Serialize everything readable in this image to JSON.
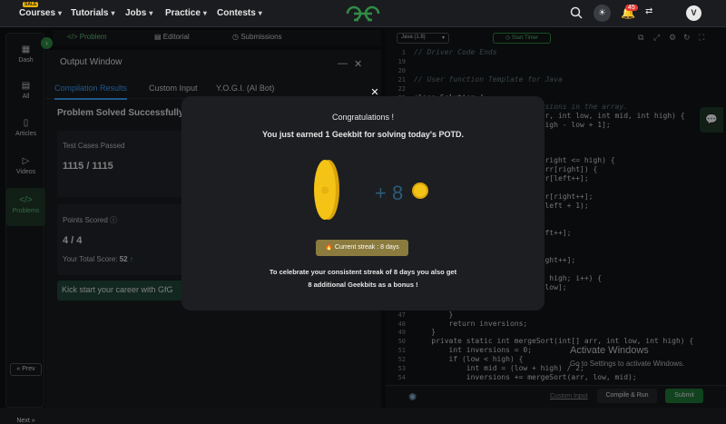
{
  "nav": {
    "sale_badge": "SALE",
    "items": [
      "Courses",
      "Tutorials",
      "Jobs",
      "Practice",
      "Contests"
    ],
    "notification_count": "45",
    "avatar_initial": "V"
  },
  "sidebar": {
    "items": [
      "Dash",
      "All",
      "Articles",
      "Videos",
      "Problems"
    ],
    "prev_label": "« Prev",
    "next_label": "Next »"
  },
  "problem_tabs": [
    "Problem",
    "Editorial",
    "Submissions"
  ],
  "output": {
    "title": "Output Window",
    "tabs": [
      "Compilation Results",
      "Custom Input",
      "Y.O.G.I. (AI Bot)"
    ],
    "status": "Problem Solved Successfully",
    "test_cases_label": "Test Cases Passed",
    "test_cases_value": "1115 / 1115",
    "points_label": "Points Scored",
    "points_value": "4 / 4",
    "total_score_label": "Your Total Score:",
    "total_score_value": "52",
    "kickstart": "Kick start your career with GfG"
  },
  "editor": {
    "language": "Java (1.8)",
    "timer_label": "Start Timer",
    "lines": [
      {
        "n": "1",
        "code": "// Driver Code Ends"
      },
      {
        "n": "19",
        "code": ""
      },
      {
        "n": "20",
        "code": ""
      },
      {
        "n": "21",
        "code": "// User function Template for Java"
      },
      {
        "n": "22",
        "code": ""
      },
      {
        "n": "23",
        "code": "class Solution {"
      },
      {
        "n": "24",
        "code": "    // Function to count inversions in the array."
      },
      {
        "n": "25",
        "code": "    static long merge(int[] arr, int low, int mid, int high) {"
      },
      {
        "n": "26",
        "code": "        int[] temp = new int[high - low + 1];"
      },
      {
        "n": "27",
        "code": ""
      },
      {
        "n": "28",
        "code": ""
      },
      {
        "n": "29",
        "code": ""
      },
      {
        "n": "30",
        "code": "        while (left <= mid && right <= high) {"
      },
      {
        "n": "31",
        "code": "            if (arr[left] <= arr[right]) {"
      },
      {
        "n": "32",
        "code": "                temp[k++] = arr[left++];"
      },
      {
        "n": "33",
        "code": "            } else {"
      },
      {
        "n": "34",
        "code": "                temp[k++] = arr[right++];"
      },
      {
        "n": "35",
        "code": "                cnt += (mid - left + 1);"
      },
      {
        "n": "36",
        "code": "            }"
      },
      {
        "n": "37",
        "code": "        }"
      },
      {
        "n": "38",
        "code": "            temp[k++] = arr[left++];"
      },
      {
        "n": "39",
        "code": ""
      },
      {
        "n": "40",
        "code": ""
      },
      {
        "n": "41",
        "code": "            temp[k++] = arr[right++];"
      },
      {
        "n": "42",
        "code": ""
      },
      {
        "n": "43",
        "code": "        for (int i = low; i <= high; i++) {"
      },
      {
        "n": "44",
        "code": "            arr[i] = temp[i - low];"
      },
      {
        "n": "45",
        "code": "        }"
      },
      {
        "n": "46",
        "code": ""
      },
      {
        "n": "47",
        "code": "        }"
      },
      {
        "n": "48",
        "code": "        return inversions;"
      },
      {
        "n": "49",
        "code": "    }"
      },
      {
        "n": "50",
        "code": "    private static int mergeSort(int[] arr, int low, int high) {"
      },
      {
        "n": "51",
        "code": "        int inversions = 0;"
      },
      {
        "n": "52",
        "code": "        if (low < high) {"
      },
      {
        "n": "53",
        "code": "            int mid = (low + high) / 2;"
      },
      {
        "n": "54",
        "code": "            inversions += mergeSort(arr, low, mid);"
      }
    ],
    "activate_title": "Activate Windows",
    "activate_sub": "Go to Settings to activate Windows.",
    "custom_input": "Custom Input",
    "compile_run": "Compile & Run",
    "submit": "Submit"
  },
  "modal": {
    "title": "Congratulations !",
    "subtitle": "You just earned 1 Geekbit for solving today's POTD.",
    "plus_amount": "+ 8",
    "streak": "🔥 Current streak : 8 days",
    "bonus_line1": "To celebrate your consistent streak of 8 days you also get",
    "bonus_line2": "8 additional Geekbits as a bonus !"
  }
}
